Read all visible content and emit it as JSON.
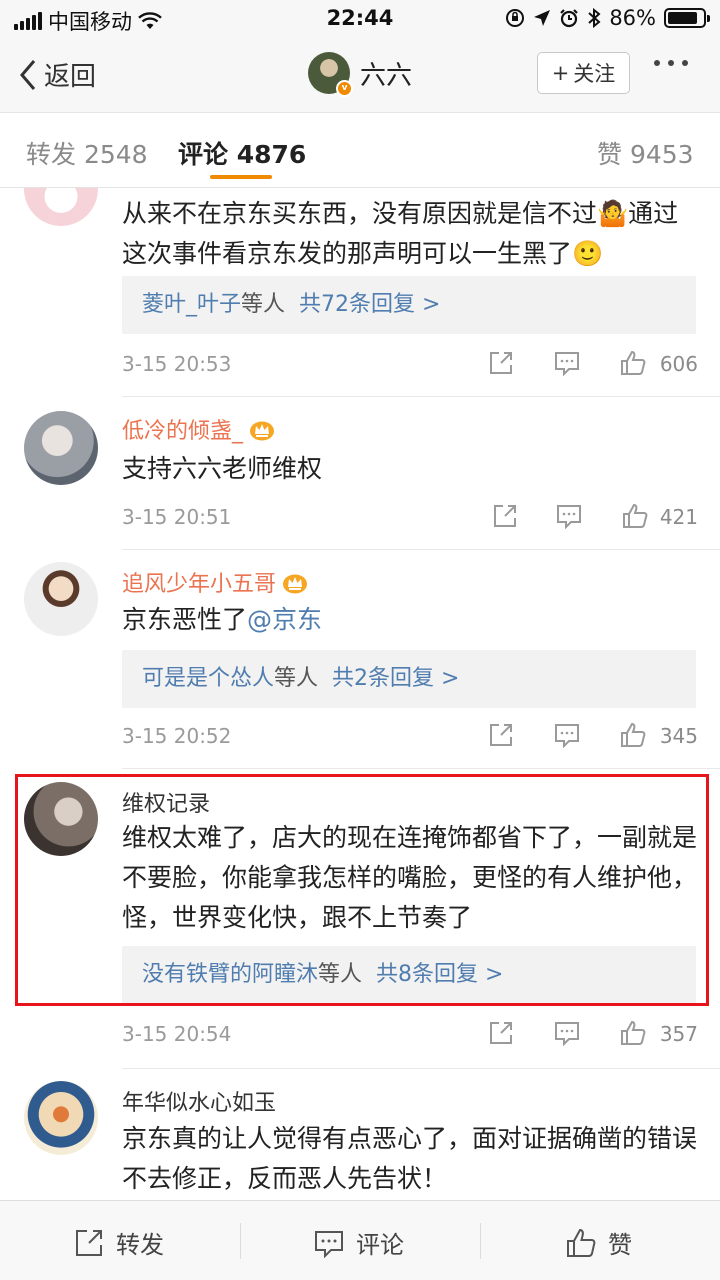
{
  "status_bar": {
    "carrier": "中国移动",
    "time": "22:44",
    "battery": "86%",
    "battery_level": 0.86
  },
  "nav": {
    "back_label": "返回",
    "title": "六六",
    "follow_label": "关注",
    "follow_plus": "+"
  },
  "tabs": {
    "repost": {
      "label": "转发",
      "count": "2548"
    },
    "comments": {
      "label": "评论",
      "count": "4876"
    },
    "likes": {
      "label": "赞",
      "count": "9453"
    }
  },
  "comments": [
    {
      "name": "",
      "text": "从来不在京东买东西，没有原因就是信不过🤷通过这次事件看京东发的那声明可以一生黑了🙂",
      "reply": {
        "names": "菱叶_叶子",
        "suffix": "等人",
        "count": "共72条回复 >"
      },
      "time": "3-15 20:53",
      "likes": "606"
    },
    {
      "name": "低冷的倾盏_",
      "text": "支持六六老师维权",
      "time": "3-15 20:51",
      "likes": "421"
    },
    {
      "name": "追风少年小五哥",
      "text_prefix": "京东恶性了",
      "mention": "@京东",
      "reply": {
        "names": "可是是个怂人",
        "suffix": "等人",
        "count": "共2条回复 >"
      },
      "time": "3-15 20:52",
      "likes": "345"
    },
    {
      "name": "维权记录",
      "text": "维权太难了，店大的现在连掩饰都省下了，一副就是不要脸，你能拿我怎样的嘴脸，更怪的有人维护他，怪，世界变化快，跟不上节奏了",
      "reply": {
        "names": "没有铁臂的阿瞳沐",
        "suffix": "等人",
        "count": "共8条回复 >"
      },
      "time": "3-15 20:54",
      "likes": "357"
    },
    {
      "name": "年华似水心如玉",
      "text": "京东真的让人觉得有点恶心了，面对证据确凿的错误不去修正，反而恶人先告状！"
    }
  ],
  "bottom_bar": {
    "repost": "转发",
    "comment": "评论",
    "like": "赞"
  },
  "colors": {
    "accent": "#f08a00",
    "link": "#507daf",
    "username": "#eb7350",
    "highlight": "#e8141c"
  }
}
